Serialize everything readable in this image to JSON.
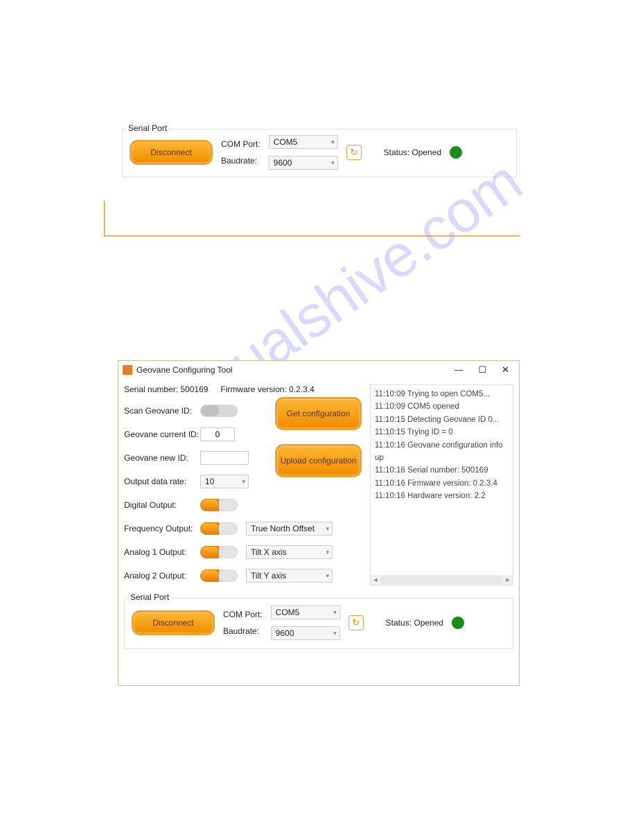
{
  "topSerial": {
    "legend": "Serial Port",
    "disconnect": "Disconnect",
    "comPortLabel": "COM Port:",
    "comPortValue": "COM5",
    "baudLabel": "Baudrate:",
    "baudValue": "9600",
    "statusLabel": "Status: Opened"
  },
  "window": {
    "title": "Geovane Configuring Tool"
  },
  "info": {
    "serialLabel": "Serial number: 500169",
    "firmwareLabel": "Firmware version: 0.2.3.4"
  },
  "form": {
    "scanLabel": "Scan Geovane ID:",
    "currentIdLabel": "Geovane current ID:",
    "currentIdValue": "0",
    "newIdLabel": "Geovane new ID:",
    "newIdValue": "",
    "outputRateLabel": "Output data rate:",
    "outputRateValue": "10",
    "digitalLabel": "Digital Output:",
    "freqLabel": "Frequency Output:",
    "freqSelect": "True North Offset",
    "an1Label": "Analog 1 Output:",
    "an1Select": "Tilt X axis",
    "an2Label": "Analog 2 Output:",
    "an2Select": "Tilt Y axis"
  },
  "buttons": {
    "getCfg": "Get configuration",
    "uploadCfg": "Upload configuration"
  },
  "log": [
    "11:10:09 Trying to open COM5...",
    "11:10:09 COM5 opened",
    "11:10:15 Detecting Geovane ID 0...",
    "11:10:15 Trying ID = 0",
    "11:10:16 Geovane configuration info up",
    "11:10:16 Serial number: 500169",
    "11:10:16 Firmware version: 0.2.3.4",
    "11:10:16 Hardware version: 2.2"
  ],
  "bottomSerial": {
    "legend": "Serial Port",
    "disconnect": "Disconnect",
    "comPortLabel": "COM Port:",
    "comPortValue": "COM5",
    "baudLabel": "Baudrate:",
    "baudValue": "9600",
    "statusLabel": "Status: Opened"
  },
  "watermark": "manualshive.com"
}
